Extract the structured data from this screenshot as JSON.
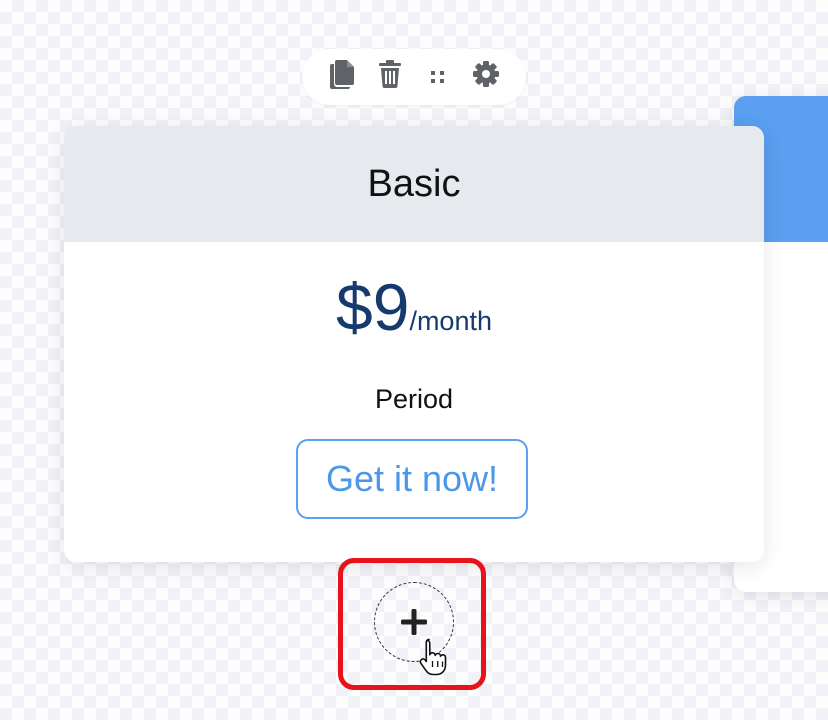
{
  "toolbar": {
    "buttons": [
      {
        "name": "duplicate",
        "icon": "copy-icon"
      },
      {
        "name": "delete",
        "icon": "trash-icon"
      },
      {
        "name": "drag",
        "icon": "drag-handle-icon"
      },
      {
        "name": "settings",
        "icon": "gear-icon"
      }
    ],
    "icon_color": "#5f6368"
  },
  "card": {
    "title": "Basic",
    "price": "$9",
    "price_unit": "/month",
    "period": "Period",
    "cta_label": "Get it now!"
  },
  "next_card": {
    "header_color": "#5a9ff0"
  },
  "add_block": {
    "icon": "plus-icon",
    "highlight_color": "#e8121a"
  },
  "cursor": {
    "icon": "hand-pointer-icon"
  },
  "colors": {
    "price": "#163a6e",
    "accent": "#5a9ff0",
    "card_header_bg": "#e6eaee"
  }
}
